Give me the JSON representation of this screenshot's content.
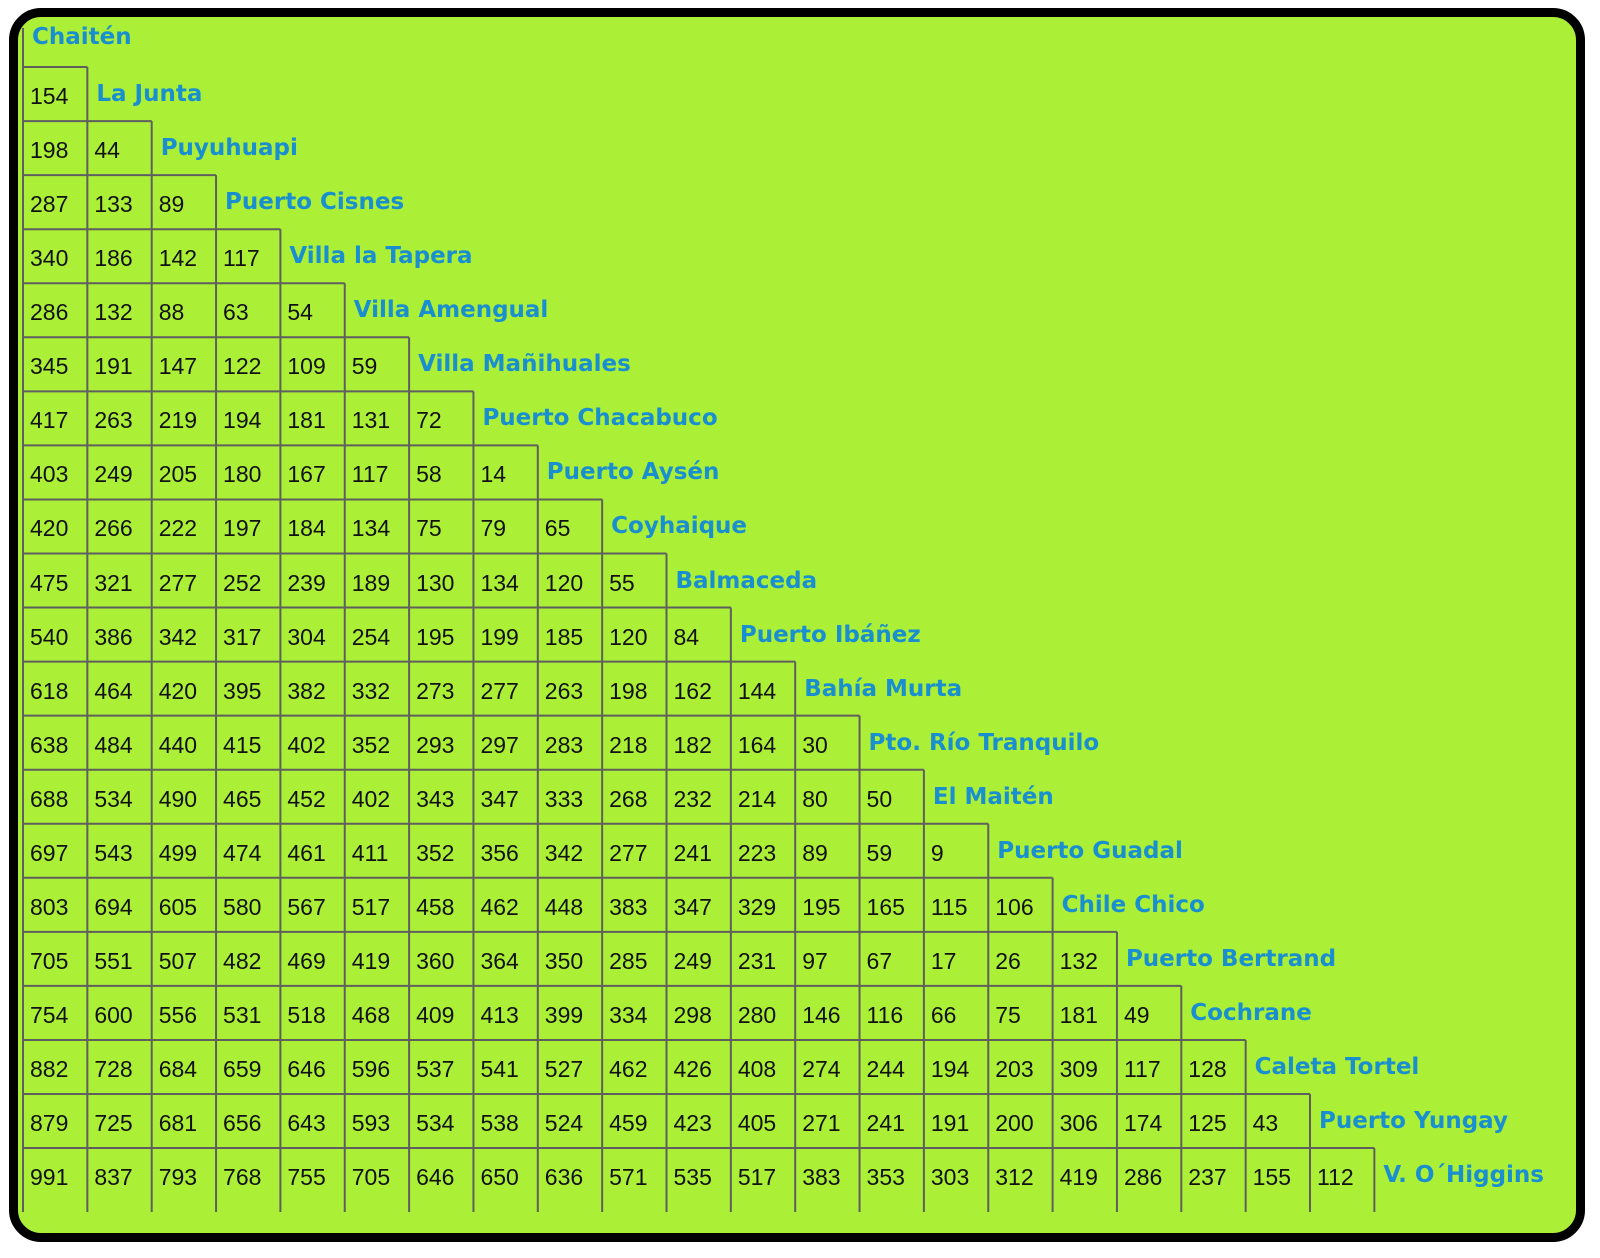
{
  "towns": [
    "Chaitén",
    "La Junta",
    "Puyuhuapi",
    "Puerto Cisnes",
    "Villa la Tapera",
    "Villa Amengual",
    "Villa Mañihuales",
    "Puerto Chacabuco",
    "Puerto Aysén",
    "Coyhaique",
    "Balmaceda",
    "Puerto Ibáñez",
    "Bahía Murta",
    "Pto. Río Tranquilo",
    "El Maitén",
    "Puerto Guadal",
    "Chile Chico",
    "Puerto Bertrand",
    "Cochrane",
    "Caleta Tortel",
    "Puerto Yungay",
    "V. O´Higgins"
  ],
  "distances": [
    [],
    [
      154
    ],
    [
      198,
      44
    ],
    [
      287,
      133,
      89
    ],
    [
      340,
      186,
      142,
      117
    ],
    [
      286,
      132,
      88,
      63,
      54
    ],
    [
      345,
      191,
      147,
      122,
      109,
      59
    ],
    [
      417,
      263,
      219,
      194,
      181,
      131,
      72
    ],
    [
      403,
      249,
      205,
      180,
      167,
      117,
      58,
      14
    ],
    [
      420,
      266,
      222,
      197,
      184,
      134,
      75,
      79,
      65
    ],
    [
      475,
      321,
      277,
      252,
      239,
      189,
      130,
      134,
      120,
      55
    ],
    [
      540,
      386,
      342,
      317,
      304,
      254,
      195,
      199,
      185,
      120,
      84
    ],
    [
      618,
      464,
      420,
      395,
      382,
      332,
      273,
      277,
      263,
      198,
      162,
      144
    ],
    [
      638,
      484,
      440,
      415,
      402,
      352,
      293,
      297,
      283,
      218,
      182,
      164,
      30
    ],
    [
      688,
      534,
      490,
      465,
      452,
      402,
      343,
      347,
      333,
      268,
      232,
      214,
      80,
      50
    ],
    [
      697,
      543,
      499,
      474,
      461,
      411,
      352,
      356,
      342,
      277,
      241,
      223,
      89,
      59,
      9
    ],
    [
      803,
      694,
      605,
      580,
      567,
      517,
      458,
      462,
      448,
      383,
      347,
      329,
      195,
      165,
      115,
      106
    ],
    [
      705,
      551,
      507,
      482,
      469,
      419,
      360,
      364,
      350,
      285,
      249,
      231,
      97,
      67,
      17,
      26,
      132
    ],
    [
      754,
      600,
      556,
      531,
      518,
      468,
      409,
      413,
      399,
      334,
      298,
      280,
      146,
      116,
      66,
      75,
      181,
      49
    ],
    [
      882,
      728,
      684,
      659,
      646,
      596,
      537,
      541,
      527,
      462,
      426,
      408,
      274,
      244,
      194,
      203,
      309,
      117,
      128
    ],
    [
      879,
      725,
      681,
      656,
      643,
      593,
      534,
      538,
      524,
      459,
      423,
      405,
      271,
      241,
      191,
      200,
      306,
      174,
      125,
      43
    ],
    [
      991,
      837,
      793,
      768,
      755,
      705,
      646,
      650,
      636,
      571,
      535,
      517,
      383,
      353,
      303,
      312,
      419,
      286,
      237,
      155,
      112
    ]
  ],
  "colors": {
    "background": "#abef37",
    "town_label": "#1a8fd0",
    "border": "#000000"
  }
}
